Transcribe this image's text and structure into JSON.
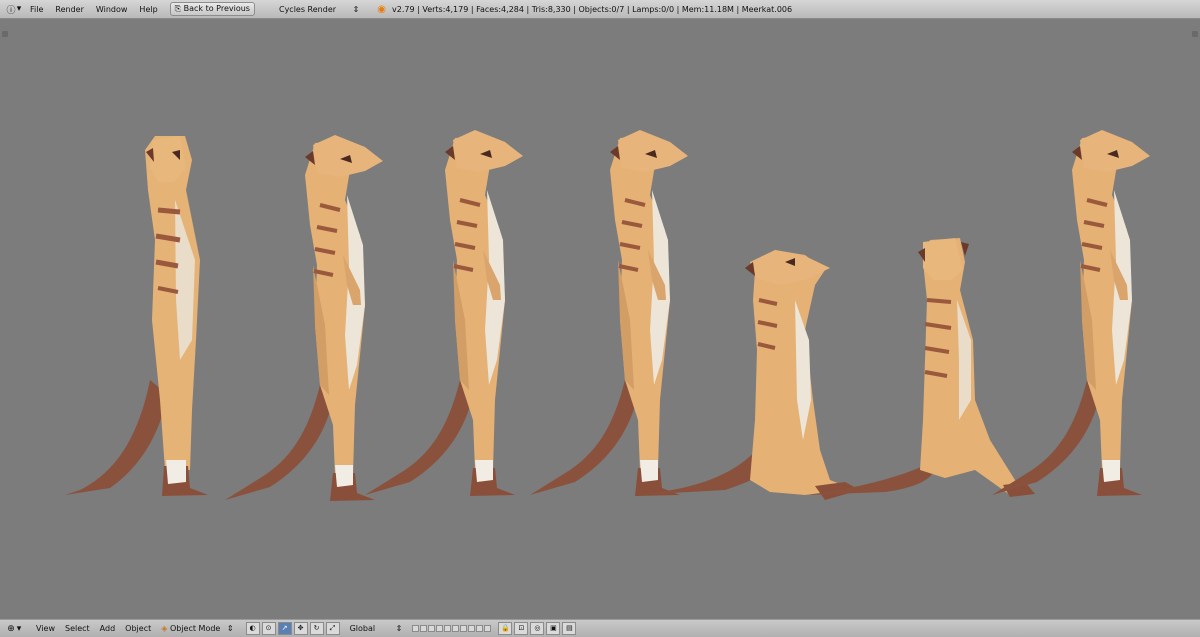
{
  "topbar": {
    "info_icon": "info-icon",
    "menus": [
      "File",
      "Render",
      "Window",
      "Help"
    ],
    "back_button": "Back to Previous",
    "engine": "Cycles Render",
    "stats": "v2.79 | Verts:4,179 | Faces:4,284 | Tris:8,330 | Objects:0/7 | Lamps:0/0 | Mem:11.18M | Meerkat.006"
  },
  "bottombar": {
    "menus": [
      "View",
      "Select",
      "Add",
      "Object"
    ],
    "mode": "Object Mode",
    "orientation": "Global"
  },
  "colors": {
    "fur": "#e7b47a",
    "fur_shadow": "#d39f68",
    "belly": "#ece6da",
    "stripe": "#9b5a3d",
    "tail": "#87503c",
    "viewport_bg": "#7c7c7c"
  }
}
